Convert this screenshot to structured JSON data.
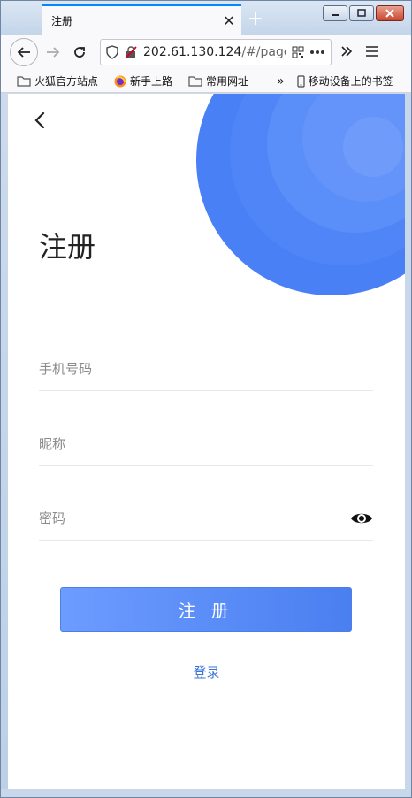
{
  "browser": {
    "tab_title": "注册",
    "tab_close": "✕",
    "new_tab": "+",
    "url_host": "202.61.130.124",
    "url_path": "/#/page",
    "bookmarks": [
      {
        "label": "火狐官方站点",
        "icon": "folder-icon"
      },
      {
        "label": "新手上路",
        "icon": "firefox-icon"
      },
      {
        "label": "常用网址",
        "icon": "folder-icon"
      }
    ],
    "bookmarks_more": "»",
    "mobile_bookmarks": "移动设备上的书签"
  },
  "page": {
    "title": "注册",
    "phone_placeholder": "手机号码",
    "nickname_placeholder": "昵称",
    "password_placeholder": "密码",
    "submit_label": "注 册",
    "login_link": "登录"
  },
  "colors": {
    "accent": "#4a7ff0",
    "link": "#3d74d8",
    "circle_outer": "#4a80f5",
    "circle_inner": "#6f9cfa"
  }
}
